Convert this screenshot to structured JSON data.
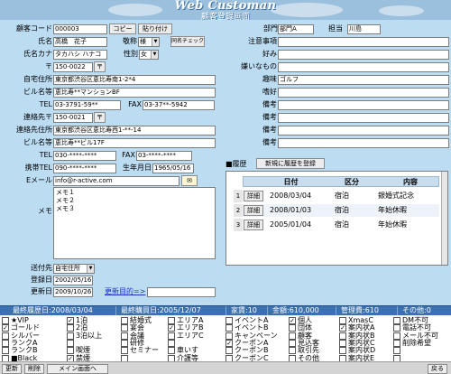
{
  "header": {
    "app_title": "Web Customan",
    "screen_title": "顧客登録画面"
  },
  "form": {
    "customer_code_label": "顧客コード",
    "customer_code": "000003",
    "copy_button": "コピー",
    "paste_button": "貼り付け",
    "name_label": "氏名",
    "name": "高橋　花子",
    "honorific_label": "敬称",
    "honorific": "様",
    "same_name_check_button": "同名チェック",
    "kana_label": "氏名カナ",
    "kana": "タカハシ ハナコ",
    "gender_label": "性別",
    "gender": "女",
    "zip_label": "〒",
    "zip": "150-0022",
    "zip_button": "〒",
    "home_address_label": "自宅住所",
    "home_address": "東京都渋谷区恵比寿南1-2*4",
    "building_label": "ビル名等",
    "building": "恵比寿**マンションBF",
    "tel_label": "TEL",
    "tel": "03-3791-59**",
    "fax_label": "FAX",
    "fax": "03-37**-5942",
    "contact_zip_label": "連絡先〒",
    "contact_zip": "150-0021",
    "contact_zip_button": "〒",
    "contact_address_label": "連絡先住所",
    "contact_address": "東京都渋谷区恵比寿西1-**-14",
    "contact_building_label": "ビル名等",
    "contact_building": "恵比寿**ビル17F",
    "contact_tel_label": "TEL",
    "contact_tel": "030-****-****",
    "contact_fax_label": "FAX",
    "contact_fax": "03-****-****",
    "mobile_label": "携帯TEL",
    "mobile": "090-****-****",
    "birthday_label": "生年月日",
    "birthday": "1965/05/16",
    "email_label": "Eメール",
    "email": "info@r-active.com",
    "memo_label": "メモ",
    "memo": "メモ１\nメモ２\nメモ３",
    "delivery_label": "送付先",
    "delivery": "自宅住所",
    "registered_label": "登録日",
    "registered": "2002/05/16",
    "updated_label": "更新日",
    "updated": "2009/10/26",
    "update_purpose_link": "更新目的=>"
  },
  "right": {
    "dept_label": "部門",
    "dept": "部門A",
    "staff_label": "担当",
    "staff": "川島",
    "notes_label": "注意事項",
    "notes": "",
    "likes_label": "好み",
    "likes": "",
    "dislikes_label": "嫌いなもの",
    "dislikes": "",
    "hobby_label": "趣味",
    "hobby": "ゴルフ",
    "preference_label": "嗜好",
    "preference": "",
    "remarks1_label": "備考",
    "remarks1": "",
    "remarks2_label": "備考",
    "remarks2": "",
    "remarks3_label": "備考",
    "remarks3": "",
    "remarks4_label": "備考",
    "remarks4": ""
  },
  "history": {
    "title": "■履歴",
    "new_button": "新規に履歴を登録",
    "columns": [
      "日付",
      "区分",
      "内容"
    ],
    "rows": [
      {
        "no": "1",
        "btn": "詳細",
        "date": "2008/03/04",
        "category": "宿泊",
        "content": "銀婚式記念"
      },
      {
        "no": "2",
        "btn": "詳細",
        "date": "2008/01/03",
        "category": "宿泊",
        "content": "年始休暇"
      },
      {
        "no": "3",
        "btn": "詳細",
        "date": "2005/01/04",
        "category": "宿泊",
        "content": "年始休暇"
      }
    ]
  },
  "summary": {
    "last_visit": "最終履歴日:2008/03/04",
    "last_purchase": "最終購買日:2005/12/07",
    "count": "家賃:10",
    "amount": "金額:610,000",
    "management": "管理費:610",
    "other": "その他:0"
  },
  "checkboxes": [
    [
      {
        "label": "★VIP",
        "checked": false
      },
      {
        "label": "ゴールド",
        "checked": true
      },
      {
        "label": "シルバー",
        "checked": false
      },
      {
        "label": "ランクA",
        "checked": false
      },
      {
        "label": "ランクB",
        "checked": false
      },
      {
        "label": "■Black",
        "checked": false
      }
    ],
    [
      {
        "label": "1泊",
        "checked": true
      },
      {
        "label": "2泊",
        "checked": false
      },
      {
        "label": "3泊以上",
        "checked": false
      },
      {
        "label": "",
        "checked": false
      },
      {
        "label": "喫煙",
        "checked": false
      },
      {
        "label": "禁煙",
        "checked": true
      }
    ],
    [
      {
        "label": "結婚式",
        "checked": false
      },
      {
        "label": "宴会",
        "checked": false
      },
      {
        "label": "会議",
        "checked": false
      },
      {
        "label": "研修",
        "checked": false
      },
      {
        "label": "セミナー",
        "checked": false
      },
      {
        "label": "",
        "checked": false
      }
    ],
    [
      {
        "label": "エリアA",
        "checked": false
      },
      {
        "label": "エリアB",
        "checked": true
      },
      {
        "label": "エリアC",
        "checked": false
      },
      {
        "label": "",
        "checked": false
      },
      {
        "label": "車いす",
        "checked": false
      },
      {
        "label": "介護等",
        "checked": false
      }
    ],
    [
      {
        "label": "イベントA",
        "checked": false
      },
      {
        "label": "イベントB",
        "checked": false
      },
      {
        "label": "キャンペーン",
        "checked": false
      },
      {
        "label": "クーポンA",
        "checked": true
      },
      {
        "label": "クーポンB",
        "checked": false
      },
      {
        "label": "クーポンC",
        "checked": false
      }
    ],
    [
      {
        "label": "個人",
        "checked": true
      },
      {
        "label": "団体",
        "checked": false
      },
      {
        "label": "顧客",
        "checked": false
      },
      {
        "label": "見込客",
        "checked": false
      },
      {
        "label": "取引先",
        "checked": false
      },
      {
        "label": "その他",
        "checked": false
      }
    ],
    [
      {
        "label": "XmasC",
        "checked": false
      },
      {
        "label": "案内状A",
        "checked": true
      },
      {
        "label": "案内状B",
        "checked": false
      },
      {
        "label": "案内状C",
        "checked": false
      },
      {
        "label": "案内状D",
        "checked": false
      },
      {
        "label": "案内状E",
        "checked": false
      }
    ],
    [
      {
        "label": "DM不可",
        "checked": false
      },
      {
        "label": "電話不可",
        "checked": false
      },
      {
        "label": "メール不可",
        "checked": false
      },
      {
        "label": "削除希望",
        "checked": false
      },
      {
        "label": "",
        "checked": false
      },
      {
        "label": "",
        "checked": false
      }
    ]
  ],
  "footer": {
    "update": "更新",
    "delete": "削除",
    "main_menu": "メイン画面へ",
    "back": "戻る"
  }
}
